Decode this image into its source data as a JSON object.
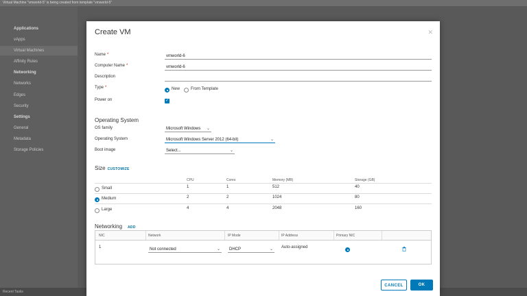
{
  "background": {
    "topbar_text": "Virtual Machine \"vmworld-5\" is being created from template \"vmworld-5\"",
    "sidebar": [
      {
        "label": "Applications",
        "head": true
      },
      {
        "label": "vApps",
        "head": false
      },
      {
        "label": "Virtual Machines",
        "head": false
      },
      {
        "label": "Affinity Rules",
        "head": false
      },
      {
        "label": "Networking",
        "head": true
      },
      {
        "label": "Networks",
        "head": false
      },
      {
        "label": "Edges",
        "head": false
      },
      {
        "label": "Security",
        "head": false
      },
      {
        "label": "Settings",
        "head": true
      },
      {
        "label": "General",
        "head": false
      },
      {
        "label": "Metadata",
        "head": false
      },
      {
        "label": "Storage Policies",
        "head": false
      }
    ],
    "bottom_text": "Recent Tasks"
  },
  "modal": {
    "title": "Create VM",
    "close_icon": "close-icon"
  },
  "form": {
    "name_label": "Name",
    "name_value": "vmworld-6",
    "computer_name_label": "Computer Name",
    "computer_name_value": "vmworld-6",
    "description_label": "Description",
    "description_value": "",
    "type_label": "Type",
    "type_new": "New",
    "type_template": "From Template",
    "type_selected": "New",
    "power_on_label": "Power on",
    "power_on_checked": true,
    "required_mark": "*"
  },
  "os": {
    "section_title": "Operating System",
    "family_label": "OS family",
    "family_value": "Microsoft Windows",
    "os_label": "Operating System",
    "os_value": "Microsoft Windows Server 2012 (64-bit)",
    "boot_label": "Boot image",
    "boot_value": "Select..."
  },
  "size": {
    "section_title": "Size",
    "customize": "CUSTOMIZE",
    "headers": [
      "CPU",
      "Cores",
      "Memory (MB)",
      "Storage (GB)"
    ],
    "rows": [
      {
        "name": "Small",
        "cpu": "1",
        "cores": "1",
        "memory": "512",
        "storage": "40",
        "selected": false
      },
      {
        "name": "Medium",
        "cpu": "2",
        "cores": "2",
        "memory": "1024",
        "storage": "80",
        "selected": true
      },
      {
        "name": "Large",
        "cpu": "4",
        "cores": "4",
        "memory": "2048",
        "storage": "160",
        "selected": false
      }
    ]
  },
  "networking": {
    "section_title": "Networking",
    "add": "ADD",
    "headers": [
      "NIC",
      "Network",
      "IP Mode",
      "IP Address",
      "Primary NIC"
    ],
    "row": {
      "nic": "1",
      "network": "Not connected",
      "ip_mode": "DHCP",
      "ip_address": "Auto-assigned",
      "primary": true
    }
  },
  "buttons": {
    "cancel": "CANCEL",
    "ok": "OK"
  },
  "colors": {
    "accent": "#0079b8",
    "required": "#c92100"
  }
}
